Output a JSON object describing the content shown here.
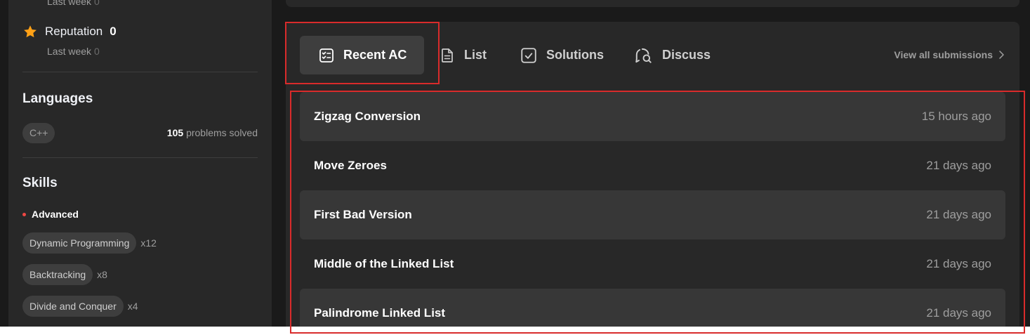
{
  "sidebar": {
    "top_lastweek": {
      "label": "Last week",
      "value": "0"
    },
    "reputation": {
      "label": "Reputation",
      "value": "0",
      "lastweek_label": "Last week",
      "lastweek_value": "0"
    },
    "languages": {
      "title": "Languages",
      "items": [
        {
          "name": "C++",
          "count": "105",
          "suffix": "problems solved"
        }
      ]
    },
    "skills": {
      "title": "Skills",
      "level": "Advanced",
      "items": [
        {
          "name": "Dynamic Programming",
          "count": "x12"
        },
        {
          "name": "Backtracking",
          "count": "x8"
        },
        {
          "name": "Divide and Conquer",
          "count": "x4"
        }
      ]
    }
  },
  "tabs": [
    {
      "label": "Recent AC",
      "icon": "checklist-icon",
      "active": true
    },
    {
      "label": "List",
      "icon": "document-icon"
    },
    {
      "label": "Solutions",
      "icon": "checkbox-icon"
    },
    {
      "label": "Discuss",
      "icon": "discuss-icon"
    }
  ],
  "view_all": "View all submissions",
  "submissions": [
    {
      "title": "Zigzag Conversion",
      "time": "15 hours ago"
    },
    {
      "title": "Move Zeroes",
      "time": "21 days ago"
    },
    {
      "title": "First Bad Version",
      "time": "21 days ago"
    },
    {
      "title": "Middle of the Linked List",
      "time": "21 days ago"
    },
    {
      "title": "Palindrome Linked List",
      "time": "21 days ago"
    }
  ],
  "colors": {
    "background": "#1a1a1a",
    "card": "#282828",
    "chip": "#3e3e3e",
    "star": "#ffa116",
    "advanced_dot": "#ef4743",
    "annotation": "#d92b2b"
  }
}
